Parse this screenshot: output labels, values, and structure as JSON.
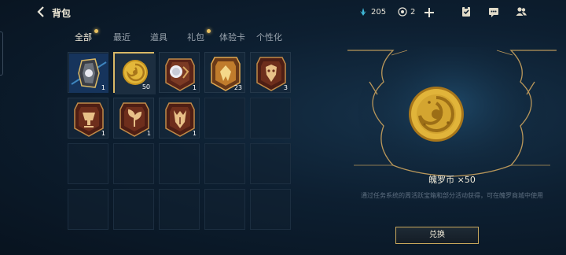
{
  "header": {
    "title": "背包",
    "back_icon": "chevron-left-icon",
    "gems": "205",
    "coins": "2",
    "add_icon": "plus-icon",
    "icons": [
      "clipboard-check-icon",
      "chat-icon",
      "friends-icon"
    ]
  },
  "tabs": [
    {
      "label": "全部",
      "active": true,
      "dot": true
    },
    {
      "label": "最近",
      "active": false,
      "dot": false
    },
    {
      "label": "道具",
      "active": false,
      "dot": false
    },
    {
      "label": "礼包",
      "active": false,
      "dot": true
    },
    {
      "label": "体验卡",
      "active": false,
      "dot": false
    },
    {
      "label": "个性化",
      "active": false,
      "dot": false
    }
  ],
  "items": [
    {
      "icon": "blue-chest-icon",
      "count": "1"
    },
    {
      "icon": "gold-coin-icon",
      "count": "50",
      "selected": true
    },
    {
      "icon": "orb-emblem-icon",
      "count": "1"
    },
    {
      "icon": "gold-emblem-icon",
      "count": "23"
    },
    {
      "icon": "mask-emblem-icon",
      "count": "3"
    },
    {
      "icon": "cup-emblem-icon",
      "count": "1"
    },
    {
      "icon": "leaf-emblem-icon",
      "count": "1"
    },
    {
      "icon": "beast-emblem-icon",
      "count": "1"
    }
  ],
  "detail": {
    "name": "魄罗币 ×50",
    "description": "通过任务系统的周活跃宝箱和部分活动获得，可在魄罗商城中使用",
    "button": "兑换"
  },
  "colors": {
    "accent_gold": "#d9b866",
    "gem_cyan": "#3fb7d6"
  }
}
